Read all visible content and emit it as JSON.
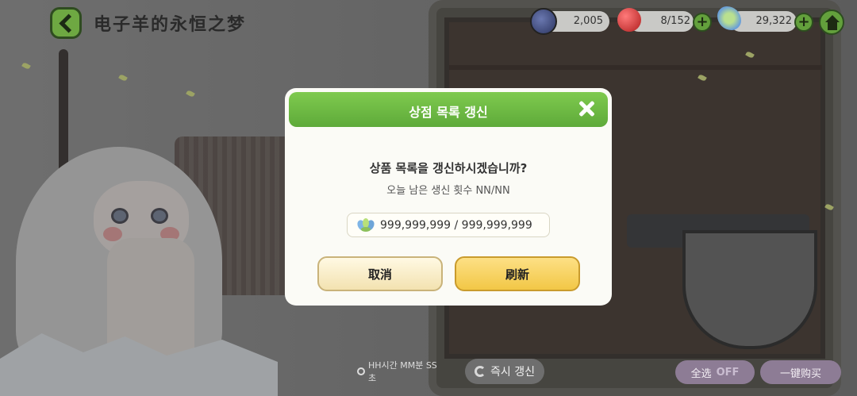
{
  "header": {
    "title": "电子羊的永恒之梦"
  },
  "resources": [
    {
      "name": "coin",
      "value": "2,005",
      "color": "#3e4a7a"
    },
    {
      "name": "red-orb",
      "value": "8/152",
      "color": "#d63a3a"
    },
    {
      "name": "crystal-flower",
      "value": "29,322",
      "color": "#7db56a"
    }
  ],
  "modal": {
    "title": "상점 목록 갱신",
    "question": "상품 목록을 갱신하시겠습니까?",
    "remaining": "오늘 남은 생신 횟수 NN/NN",
    "cost": "999,999,999 / 999,999,999",
    "cancel_label": "取消",
    "refresh_label": "刷新"
  },
  "bottom": {
    "timer": "HH시간 MM분 SS초",
    "refresh_now": "즉시 갱신",
    "select_all": "全选",
    "select_all_state": "OFF",
    "one_click": "一键购买"
  },
  "colors": {
    "accent_green": "#5eaa3a",
    "button_yellow": "#f2c746",
    "button_cream": "#f3e2b0"
  }
}
